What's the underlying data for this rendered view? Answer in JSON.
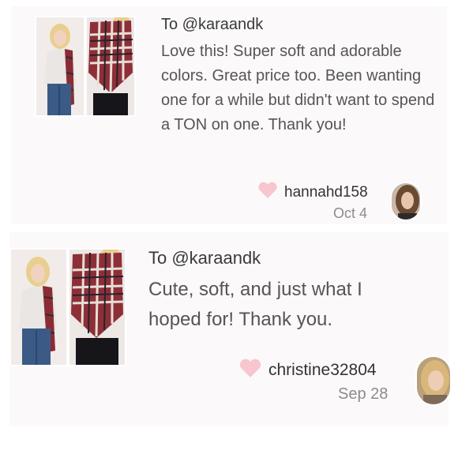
{
  "reviews": [
    {
      "to": "To @karaandk",
      "message": "Love this! Super soft and adorable colors. Great price too. Been wanting one for a while but didn't want to spend a TON on one. Thank you!",
      "username": "hannahd158",
      "date": "Oct 4"
    },
    {
      "to": "To @karaandk",
      "message": "Cute, soft, and just what I hoped for! Thank you.",
      "username": "christine32804",
      "date": "Sep 28"
    }
  ],
  "colors": {
    "heart": "#f7c6cf",
    "card_bg": "#fbf9fa"
  },
  "icons": {
    "like": "heart-icon"
  }
}
